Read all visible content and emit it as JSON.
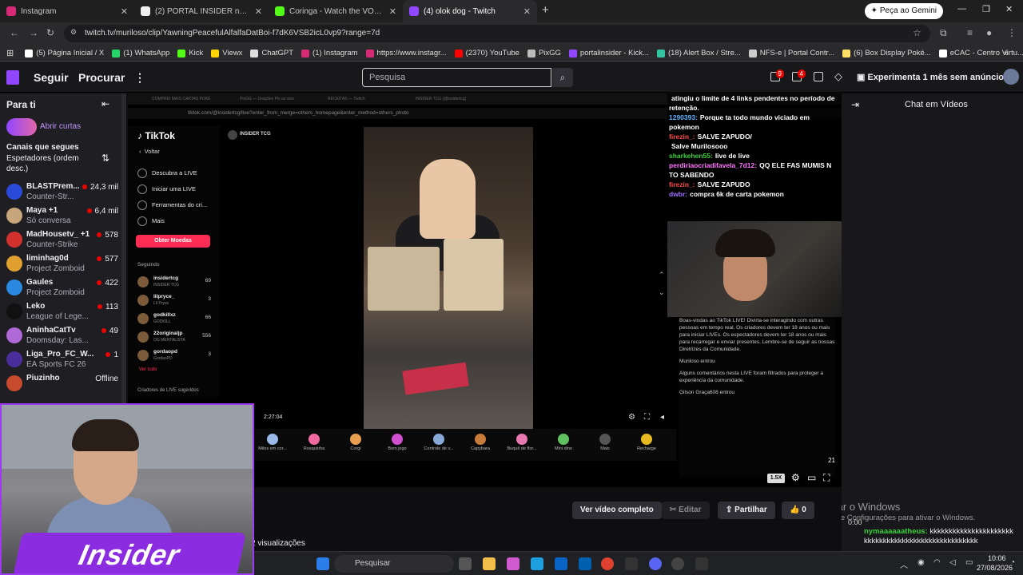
{
  "browser": {
    "tabs": [
      {
        "title": "Instagram",
        "color": "#d62976"
      },
      {
        "title": "(2) PORTAL INSIDER no X: \"",
        "color": "#eeeeee"
      },
      {
        "title": "Coringa - Watch the VOD on K",
        "color": "#53fc18"
      },
      {
        "title": "(4) olok dog - Twitch",
        "color": "#9146ff"
      }
    ],
    "new_tab": "+",
    "gemini_button": "Peça ao Gemini",
    "url": "twitch.tv/murilosо/clip/YawningPeacefulAlfalfaDatBoi-f7dK6VSB2icL0vp9?range=7d",
    "bookmarks": [
      {
        "label": "(5) Página Inicial / X",
        "color": "#ffffff"
      },
      {
        "label": "(1) WhatsApp",
        "color": "#25d366"
      },
      {
        "label": "Kick",
        "color": "#53fc18"
      },
      {
        "label": "Viewx",
        "color": "#ffd400"
      },
      {
        "label": "ChatGPT",
        "color": "#dddddd"
      },
      {
        "label": "(1) Instagram",
        "color": "#d62976"
      },
      {
        "label": "https://www.instagr...",
        "color": "#d62976"
      },
      {
        "label": "(2370) YouTube",
        "color": "#ff0000"
      },
      {
        "label": "PixGG",
        "color": "#bbbbbb"
      },
      {
        "label": "portalinsider - Kick...",
        "color": "#9146ff"
      },
      {
        "label": "(18) Alert Box / Stre...",
        "color": "#31c3a2"
      },
      {
        "label": "NFS-e | Portal Contr...",
        "color": "#cccccc"
      },
      {
        "label": "(6) Box Display Poké...",
        "color": "#ffe066"
      },
      {
        "label": "eCAC - Centro Virtu...",
        "color": "#ffffff"
      }
    ]
  },
  "twitch": {
    "nav": {
      "follow": "Seguir",
      "browse": "Procurar",
      "search_placeholder": "Pesquisa",
      "inbox_badge": "9",
      "drops_badge": "4",
      "promo": "Experimenta 1 mês sem anúncios"
    },
    "sidebar": {
      "title": "Para ti",
      "open_shorts": "Abrir curtas",
      "followed_label": "Canais que segues",
      "sort_label": "Espetadores (ordem desc.)",
      "channels": [
        {
          "name": "BLASTPrem...",
          "game": "Counter-Str...",
          "viewers": "24,3 mil",
          "color": "#2a4bd8"
        },
        {
          "name": "Maya +1",
          "game": "Só conversa",
          "viewers": "6,4 mil",
          "color": "#c8a67b"
        },
        {
          "name": "MadHousetv_ +1",
          "game": "Counter-Strike",
          "viewers": "578",
          "color": "#d0312d"
        },
        {
          "name": "liminhag0d",
          "game": "Project Zomboid",
          "viewers": "577",
          "color": "#e0a030"
        },
        {
          "name": "Gaules",
          "game": "Project Zomboid",
          "viewers": "422",
          "color": "#2b8ae0"
        },
        {
          "name": "Leko",
          "game": "League of Lege...",
          "viewers": "113",
          "color": "#111111"
        },
        {
          "name": "AninhaCatTv",
          "game": "Doomsday: Las...",
          "viewers": "49",
          "color": "#b06ad8"
        },
        {
          "name": "Liga_Pro_FC_W...",
          "game": "EA Sports FC 26",
          "viewers": "1",
          "color": "#4a2d9a"
        },
        {
          "name": "Piuzinho",
          "game": "",
          "viewers": "Offline",
          "color": "#c64b2c"
        }
      ]
    },
    "right_panel": {
      "title": "Chat em Vídeos",
      "watermark1": "Ativar o Windows",
      "watermark2": "Acesse Configurações para ativar o Windows.",
      "chat_time": "0:00",
      "chat_user": "nymaaaaaatheus:",
      "chat_msg": "kkkkkkkkkkkkkkkkkkkkkkkkkkkkkkkkkkkkkkkkkkkkkkkkkkkk"
    },
    "clip_actions": {
      "full_video": "Ver vídeo completo",
      "edit": "Editar",
      "share": "Partilhar",
      "likes": "0",
      "views": "2 visualizações"
    }
  },
  "video": {
    "inner_url": "tiktok.com/@insidertcg/live?enter_from_merge=others_homepage&enter_method=others_photo",
    "inner_tabs": [
      "COMPREI MAIS CARTAS POKÉ",
      "PixGG — Doações Pix ao vivo",
      "RECEITAS — Twitch",
      "INSIDER TCG (@insidertcg)"
    ],
    "tiktok": {
      "logo": "TikTok",
      "back": "Voltar",
      "nav": [
        "Descubra a LIVE",
        "Iniciar uma LIVE",
        "Ferramentas do cri...",
        "Mais"
      ],
      "coins": "Obter Moedas",
      "following_label": "Seguindo",
      "following": [
        {
          "name": "insidertcg",
          "sub": "INSIDER TCG",
          "count": "69"
        },
        {
          "name": "lilpryce_",
          "sub": "Lil Pryce",
          "count": "3"
        },
        {
          "name": "godkillxz",
          "sub": "GODKILL",
          "count": "66"
        },
        {
          "name": "22originaljp",
          "sub": "OG MENTALISTA",
          "count": "556"
        },
        {
          "name": "gordaopd",
          "sub": "GordaoPD",
          "count": "3"
        }
      ],
      "see_all": "Ver tudo",
      "suggested": "Criadores de LIVE sugeridos",
      "host": "INSIDER TCG",
      "elapsed": "2:27:04",
      "speed": "1.5X"
    },
    "gifts": [
      {
        "name": "Milos em cor...",
        "color": "#9ab8e8"
      },
      {
        "name": "Rosquinha",
        "color": "#f06aa0"
      },
      {
        "name": "Corgi",
        "color": "#e8a050"
      },
      {
        "name": "Bom jogo",
        "color": "#d050d0"
      },
      {
        "name": "Controle de v...",
        "color": "#88a8d8"
      },
      {
        "name": "Capybara",
        "color": "#c87a3a"
      },
      {
        "name": "Buquê de flor...",
        "color": "#e878b0"
      },
      {
        "name": "Mini dino",
        "color": "#60c060"
      },
      {
        "name": "Mais",
        "color": "#555555"
      },
      {
        "name": "Recharge",
        "color": "#e8b820"
      }
    ],
    "chat": [
      {
        "user": "",
        "msg": "atingiu o limite de 4 links pendentes no período de retenção.",
        "color": "#ffffff"
      },
      {
        "user": "1290393:",
        "msg": "Porque ta todo mundo viciado em pokemon",
        "color": "#5fb3ff"
      },
      {
        "user": "firezin_:",
        "msg": "SALVE ZAPUDO/",
        "color": "#ff4a4a"
      },
      {
        "user": "",
        "msg": "Salve Murilosooo",
        "color": "#5f7bff"
      },
      {
        "user": "sharkehen55:",
        "msg": "live de live",
        "color": "#3ad13a"
      },
      {
        "user": "perdiriaocriadifavela_7d12:",
        "msg": "QQ ELE FAS MUMIS N TO SABENDO",
        "color": "#ff77ff"
      },
      {
        "user": "firezin_:",
        "msg": "SALVE ZAPUDO",
        "color": "#ff4a4a"
      },
      {
        "user": "dwbr:",
        "msg": "compra 6k de carta pokemon",
        "color": "#a070ff"
      }
    ],
    "tt_chat": [
      "Boas-vindas ao TikTok LIVE! Divirta-se interagindo com outras pessoas em tempo real. Os criadores devem ter 18 anos ou mais para iniciar LIVEs. Os espectadores devem ter 18 anos ou mais para recarregar e enviar presentes. Lembre-se de seguir as nossas Diretrizes da Comunidade.",
      "Murilosо entrou",
      "Alguns comentários nesta LIVE foram filtrados para proteger a experiência da comunidade.",
      "Gilson Graça608 entrou"
    ],
    "viewer_count": "21"
  },
  "webcam": {
    "logo_text": "Insider"
  },
  "taskbar": {
    "search": "Pesquisar",
    "time": "10:06",
    "date": "27/08/2026"
  }
}
